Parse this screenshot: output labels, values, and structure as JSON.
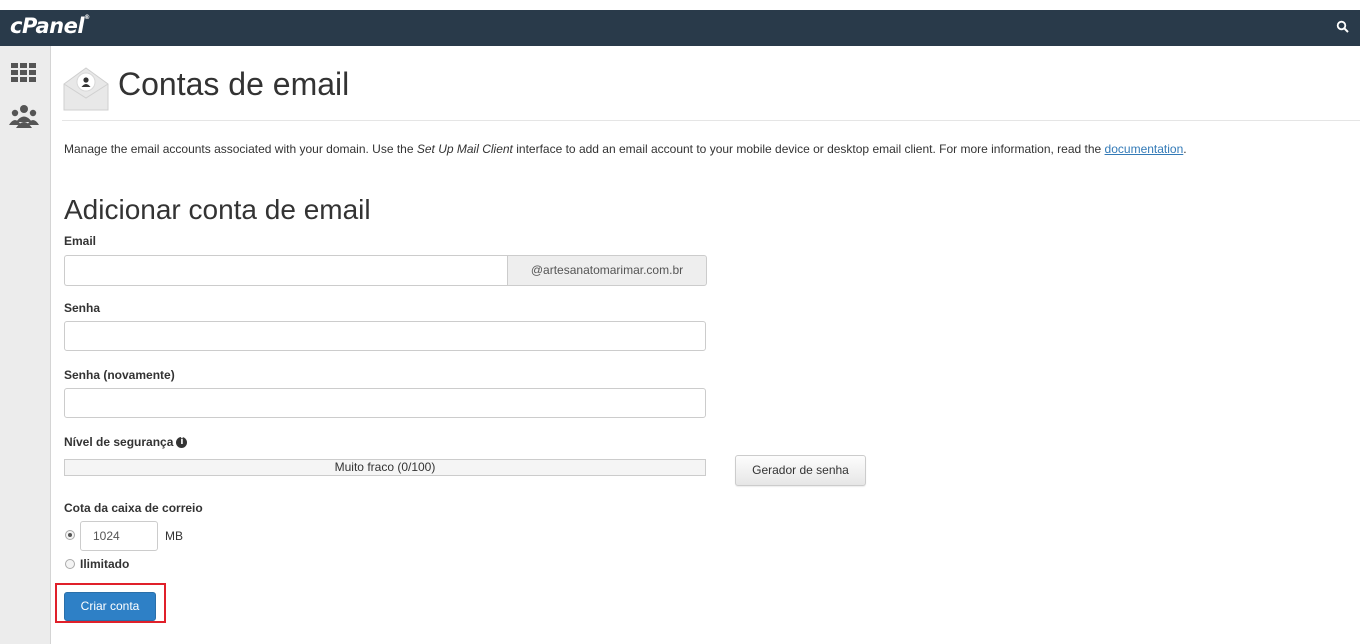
{
  "app": {
    "logo": "cPanel",
    "logo_mark": "®"
  },
  "topbar": {
    "search_icon": "search-icon"
  },
  "sidebar": {
    "items": [
      {
        "icon": "grid-icon"
      },
      {
        "icon": "users-icon"
      }
    ]
  },
  "header": {
    "title": "Contas de email",
    "icon": "envelope-user-icon"
  },
  "intro": {
    "part1": "Manage the email accounts associated with your domain. Use the ",
    "emphasis": "Set Up Mail Client",
    "part2": " interface to add an email account to your mobile device or desktop email client. For more information, read the ",
    "link": "documentation",
    "part3": "."
  },
  "form": {
    "section_title": "Adicionar conta de email",
    "email_label": "Email",
    "email_value": "",
    "domain_suffix": "@artesanatomarimar.com.br",
    "password_label": "Senha",
    "password_value": "",
    "password_again_label": "Senha (novamente)",
    "password_again_value": "",
    "strength_label": "Nível de segurança",
    "strength_text": "Muito fraco (0/100)",
    "strength_fraction": 0,
    "generator_button": "Gerador de senha",
    "quota_label": "Cota da caixa de correio",
    "quota_value": "1024",
    "quota_unit": "MB",
    "quota_selected": "limited",
    "unlimited_label": "Ilimitado",
    "submit_button": "Criar conta"
  },
  "colors": {
    "topbar": "#293a4a",
    "primary": "#2e80c6",
    "highlight": "#e0202a",
    "link": "#337ab7"
  }
}
